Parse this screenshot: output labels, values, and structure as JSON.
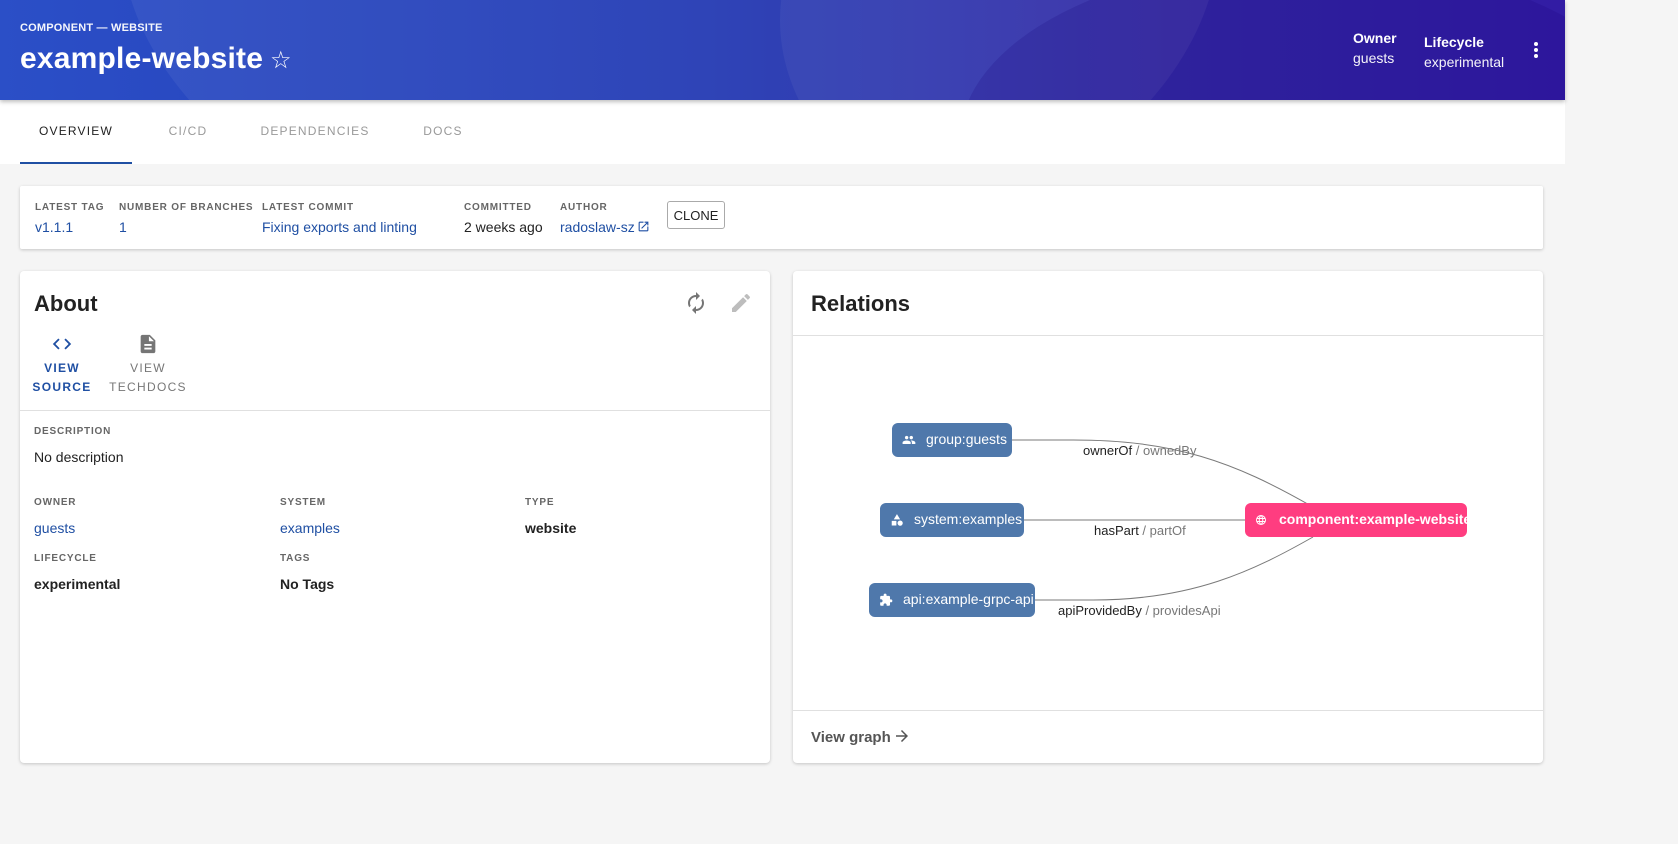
{
  "header": {
    "kind": "COMPONENT — WEBSITE",
    "title": "example-website",
    "owner_label": "Owner",
    "owner_value": "guests",
    "lifecycle_label": "Lifecycle",
    "lifecycle_value": "experimental"
  },
  "tabs": [
    {
      "label": "OVERVIEW",
      "active": true
    },
    {
      "label": "CI/CD"
    },
    {
      "label": "DEPENDENCIES"
    },
    {
      "label": "DOCS"
    }
  ],
  "summary": {
    "latest_tag_label": "LATEST TAG",
    "latest_tag": "v1.1.1",
    "branches_label": "NUMBER OF BRANCHES",
    "branches": "1",
    "commit_label": "LATEST COMMIT",
    "commit": "Fixing exports and linting",
    "committed_label": "COMMITTED",
    "committed": "2 weeks ago",
    "author_label": "AUTHOR",
    "author": "radoslaw-sz",
    "clone_label": "CLONE"
  },
  "about": {
    "title": "About",
    "view_source_1": "VIEW",
    "view_source_2": "SOURCE",
    "view_techdocs_1": "VIEW",
    "view_techdocs_2": "TECHDOCS",
    "description_label": "DESCRIPTION",
    "description": "No description",
    "owner_label": "OWNER",
    "owner": "guests",
    "system_label": "SYSTEM",
    "system": "examples",
    "type_label": "TYPE",
    "type": "website",
    "lifecycle_label": "LIFECYCLE",
    "lifecycle": "experimental",
    "tags_label": "TAGS",
    "tags": "No Tags"
  },
  "relations": {
    "title": "Relations",
    "view_graph": "View graph",
    "nodes": {
      "group": "group:guests",
      "system": "system:examples",
      "api": "api:example-grpc-api",
      "component": "component:example-website"
    },
    "edges": {
      "owner_primary": "ownerOf",
      "owner_secondary": " / ownedBy",
      "part_primary": "hasPart",
      "part_secondary": " / partOf",
      "api_primary": "apiProvidedBy",
      "api_secondary": " / providesApi"
    }
  },
  "colors": {
    "accent": "#1f4fa3",
    "node_blue": "#4f78ab",
    "node_pink": "#ff3d80",
    "header_start": "#2b4fc7",
    "header_end": "#2810a0"
  },
  "icons": {
    "favorite": "star-outline-icon",
    "menu": "more-vert-icon",
    "refresh": "refresh-icon",
    "edit": "edit-icon",
    "source": "code-icon",
    "docs": "description-icon",
    "external": "open-in-new-icon",
    "view_graph": "arrow-forward-icon"
  }
}
